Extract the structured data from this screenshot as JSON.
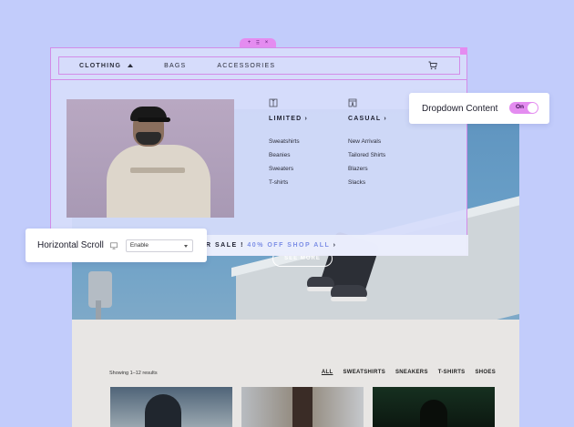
{
  "nav": {
    "items": [
      {
        "label": "CLOTHING"
      },
      {
        "label": "BAGS"
      },
      {
        "label": "ACCESSORIES"
      }
    ],
    "cart_icon": "cart-icon"
  },
  "builder": {
    "handle_icons": [
      "plus-icon",
      "drag-icon",
      "close-icon"
    ],
    "handle_glyphs": [
      "+",
      "⠿",
      "×"
    ]
  },
  "dropdown": {
    "columns": [
      {
        "title": "LIMITED",
        "icon": "shirt-icon",
        "links": [
          "Sweatshirts",
          "Beanies",
          "Sweaters",
          "T-shirts"
        ]
      },
      {
        "title": "CASUAL",
        "icon": "pants-icon",
        "links": [
          "New Arrivals",
          "Tailored Shirts",
          "Blazers",
          "Slacks"
        ]
      }
    ],
    "sale": {
      "prefix": "R SALE !",
      "accent": "40% OFF SHOP ALL"
    }
  },
  "hero": {
    "button": "SEE MORE"
  },
  "shop": {
    "results": "Showing 1–12 results",
    "filters": [
      "ALL",
      "SWEATSHIRTS",
      "SNEAKERS",
      "T-SHIRTS",
      "SHOES"
    ]
  },
  "panels": {
    "dropdown_content": {
      "label": "Dropdown Content",
      "toggle": "On"
    },
    "horizontal_scroll": {
      "label": "Horizontal Scroll",
      "value": "Enable"
    }
  },
  "colors": {
    "accent": "#e48cf0",
    "background": "#c2ccfb",
    "sale_accent": "#7d8fe6"
  }
}
